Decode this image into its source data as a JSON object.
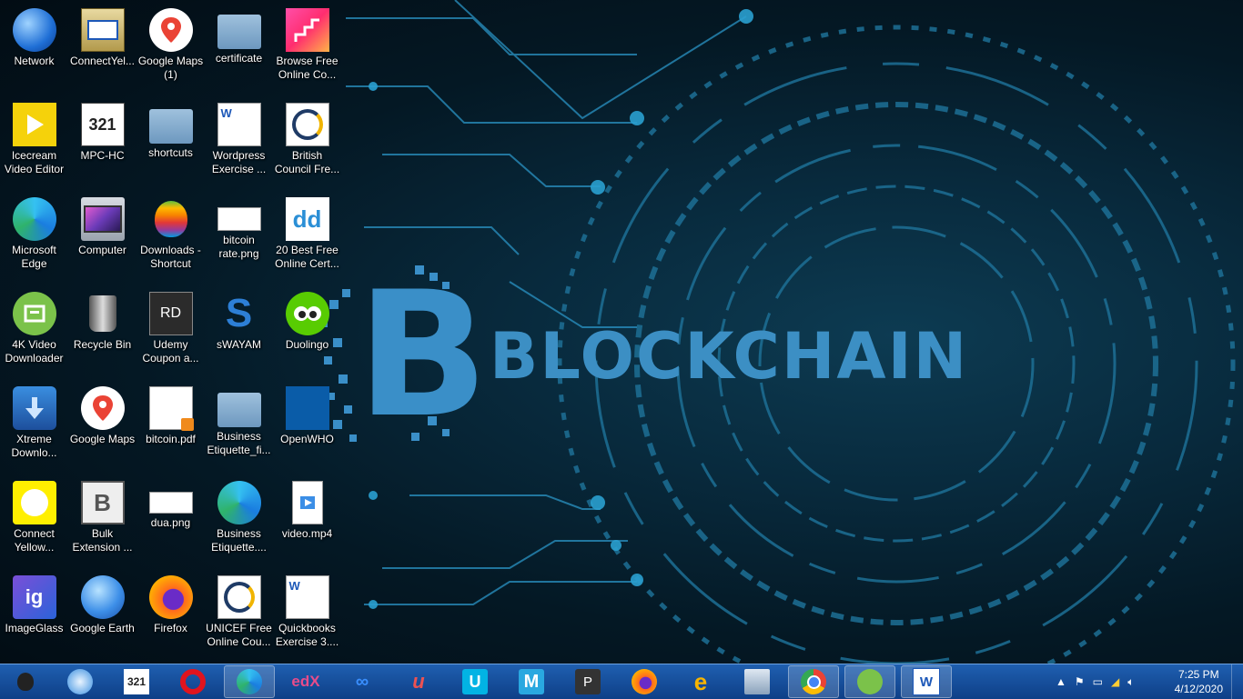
{
  "wallpaper": {
    "title": "BLOCKCHAIN",
    "letter": "B",
    "accent": "#3c8fc4"
  },
  "desktop_icons": [
    {
      "label": "Network",
      "icon": "network-globe-icon"
    },
    {
      "label": "ConnectYel...",
      "icon": "installer-box-icon"
    },
    {
      "label": "Google Maps (1)",
      "icon": "google-maps-icon"
    },
    {
      "label": "certificate",
      "icon": "folder-icon"
    },
    {
      "label": "Browse Free Online Co...",
      "icon": "staircase-gradient-icon"
    },
    {
      "label": "Icecream Video Editor",
      "icon": "icecream-play-icon"
    },
    {
      "label": "MPC-HC",
      "icon": "mpc-clapper-icon"
    },
    {
      "label": "shortcuts",
      "icon": "folder-icon"
    },
    {
      "label": "Wordpress Exercise ...",
      "icon": "word-document-icon"
    },
    {
      "label": "British Council Fre...",
      "icon": "certificate-logo-icon"
    },
    {
      "label": "Microsoft Edge",
      "icon": "edge-icon"
    },
    {
      "label": "Computer",
      "icon": "monitor-icon"
    },
    {
      "label": "Downloads - Shortcut",
      "icon": "apple-rainbow-icon"
    },
    {
      "label": "bitcoin rate.png",
      "icon": "image-thumbnail-icon"
    },
    {
      "label": "20 Best Free Online Cert...",
      "icon": "dd-logo-icon"
    },
    {
      "label": "4K Video Downloader",
      "icon": "4k-downloader-icon"
    },
    {
      "label": "Recycle Bin",
      "icon": "recycle-bin-icon"
    },
    {
      "label": "Udemy Coupon a...",
      "icon": "rd-logo-icon"
    },
    {
      "label": "sWAYAM",
      "icon": "swayam-s-icon"
    },
    {
      "label": "Duolingo",
      "icon": "duolingo-owl-icon"
    },
    {
      "label": "Xtreme Downlo...",
      "icon": "xtreme-download-icon"
    },
    {
      "label": "Google Maps",
      "icon": "google-maps-icon"
    },
    {
      "label": "bitcoin.pdf",
      "icon": "pdf-document-icon"
    },
    {
      "label": "Business Etiquette_fi...",
      "icon": "folder-icon"
    },
    {
      "label": "OpenWHO",
      "icon": "openwho-logo-icon"
    },
    {
      "label": "Connect Yellow...",
      "icon": "yellow-circle-icon"
    },
    {
      "label": "Bulk Extension ...",
      "icon": "bulk-extension-icon"
    },
    {
      "label": "dua.png",
      "icon": "image-thumbnail-icon"
    },
    {
      "label": "Business Etiquette....",
      "icon": "edge-icon"
    },
    {
      "label": "video.mp4",
      "icon": "video-file-icon"
    },
    {
      "label": "ImageGlass",
      "icon": "imageglass-icon"
    },
    {
      "label": "Google Earth",
      "icon": "google-earth-icon"
    },
    {
      "label": "Firefox",
      "icon": "firefox-icon"
    },
    {
      "label": "UNICEF Free Online Cou...",
      "icon": "certificate-logo-icon"
    },
    {
      "label": "Quickbooks Exercise 3....",
      "icon": "word-document-icon"
    }
  ],
  "taskbar": {
    "items": [
      {
        "icon": "apple-start-icon"
      },
      {
        "icon": "safari-compass-icon"
      },
      {
        "icon": "mpc-clapper-icon"
      },
      {
        "icon": "opera-icon"
      },
      {
        "icon": "edge-icon",
        "active": true
      },
      {
        "icon": "edx-icon",
        "text": "edX"
      },
      {
        "icon": "coursera-icon"
      },
      {
        "icon": "udemy-icon"
      },
      {
        "icon": "udacity-icon"
      },
      {
        "icon": "mindmap-m-icon"
      },
      {
        "icon": "p-app-icon",
        "text": "P"
      },
      {
        "icon": "firefox-icon"
      },
      {
        "icon": "internet-explorer-icon"
      },
      {
        "icon": "library-icon"
      },
      {
        "icon": "chrome-icon"
      },
      {
        "icon": "4k-downloader-icon"
      },
      {
        "icon": "word-icon"
      }
    ],
    "tray": {
      "time": "7:25 PM",
      "date": "4/12/2020"
    }
  }
}
